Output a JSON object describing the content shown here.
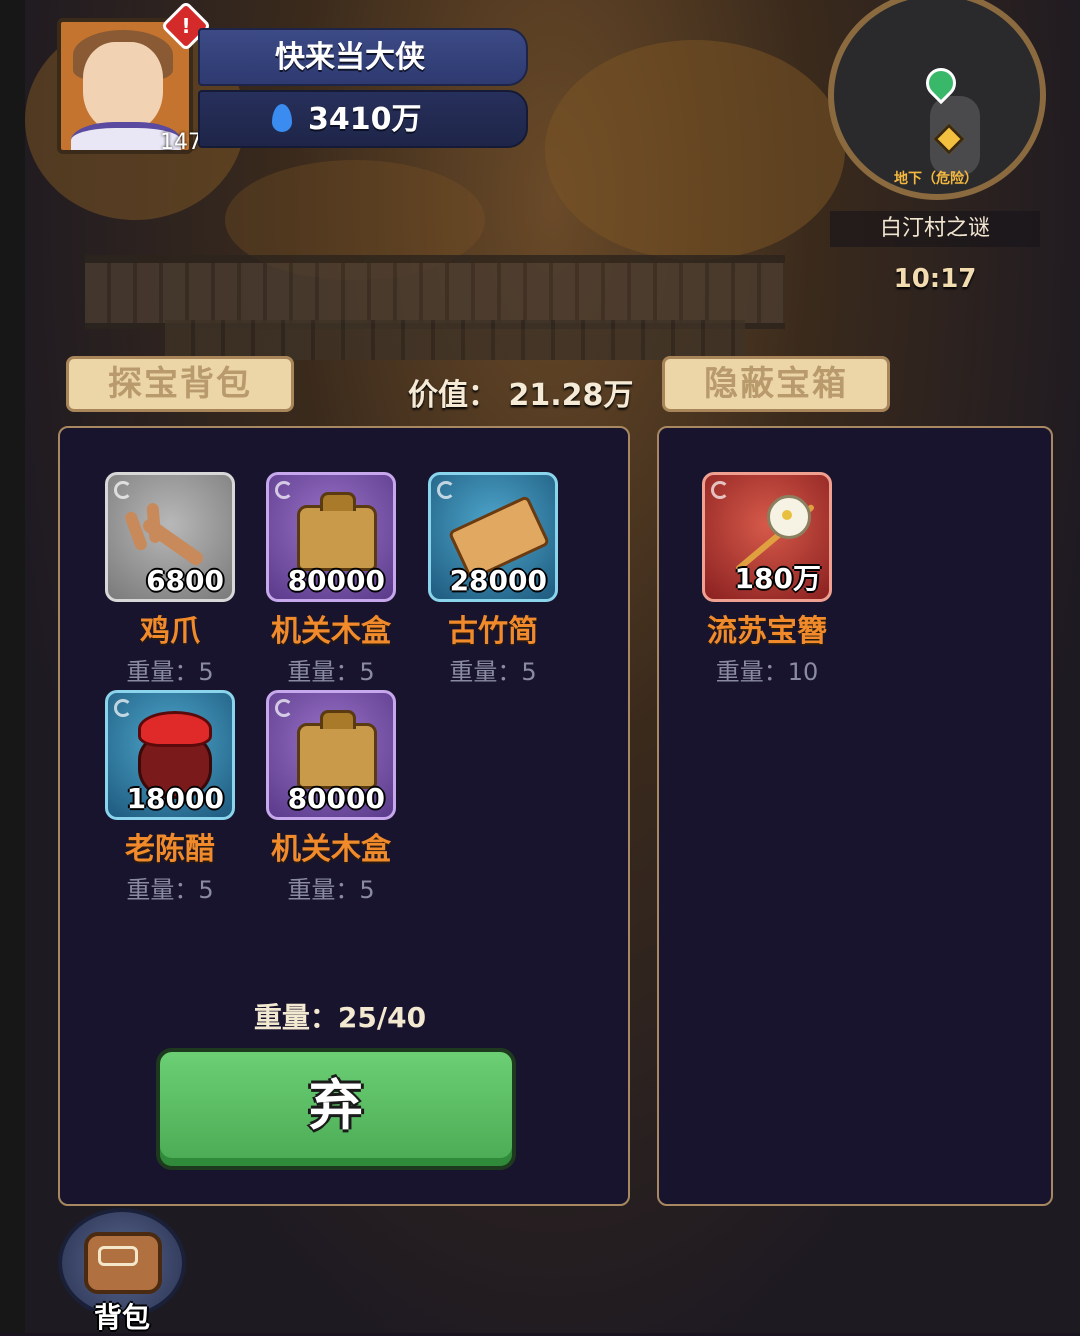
{
  "player": {
    "name": "快来当大侠",
    "currency": "3410万",
    "level": "147",
    "alert": "!"
  },
  "map": {
    "area_label": "地下（危险）",
    "quest_name": "白汀村之谜",
    "timer": "10:17"
  },
  "tabs": {
    "bag": "探宝背包",
    "chest": "隐蔽宝箱"
  },
  "value": {
    "label": "价值：",
    "amount": "21.28万"
  },
  "bag_items": [
    {
      "name": "鸡爪",
      "price": "6800",
      "weight": "重量：5",
      "rarity": "gray",
      "icon": "claw-icon"
    },
    {
      "name": "机关木盒",
      "price": "80000",
      "weight": "重量：5",
      "rarity": "purple",
      "icon": "wooden-box-icon"
    },
    {
      "name": "古竹简",
      "price": "28000",
      "weight": "重量：5",
      "rarity": "blue",
      "icon": "bamboo-scroll-icon"
    },
    {
      "name": "老陈醋",
      "price": "18000",
      "weight": "重量：5",
      "rarity": "blue",
      "icon": "vinegar-jar-icon"
    },
    {
      "name": "机关木盒",
      "price": "80000",
      "weight": "重量：5",
      "rarity": "purple",
      "icon": "wooden-box-icon"
    }
  ],
  "chest_items": [
    {
      "name": "流苏宝簪",
      "price": "180万",
      "weight": "重量：10",
      "rarity": "red",
      "icon": "hairpin-icon"
    }
  ],
  "bag_weight": "重量：25/40",
  "discard_label": "弃",
  "bottom_button": "背包",
  "colors": {
    "item_name": "#f08a2a",
    "discard_button": "#5ec064",
    "panel_bg": "#18142e",
    "tab_bg": "#ecd6a8"
  }
}
